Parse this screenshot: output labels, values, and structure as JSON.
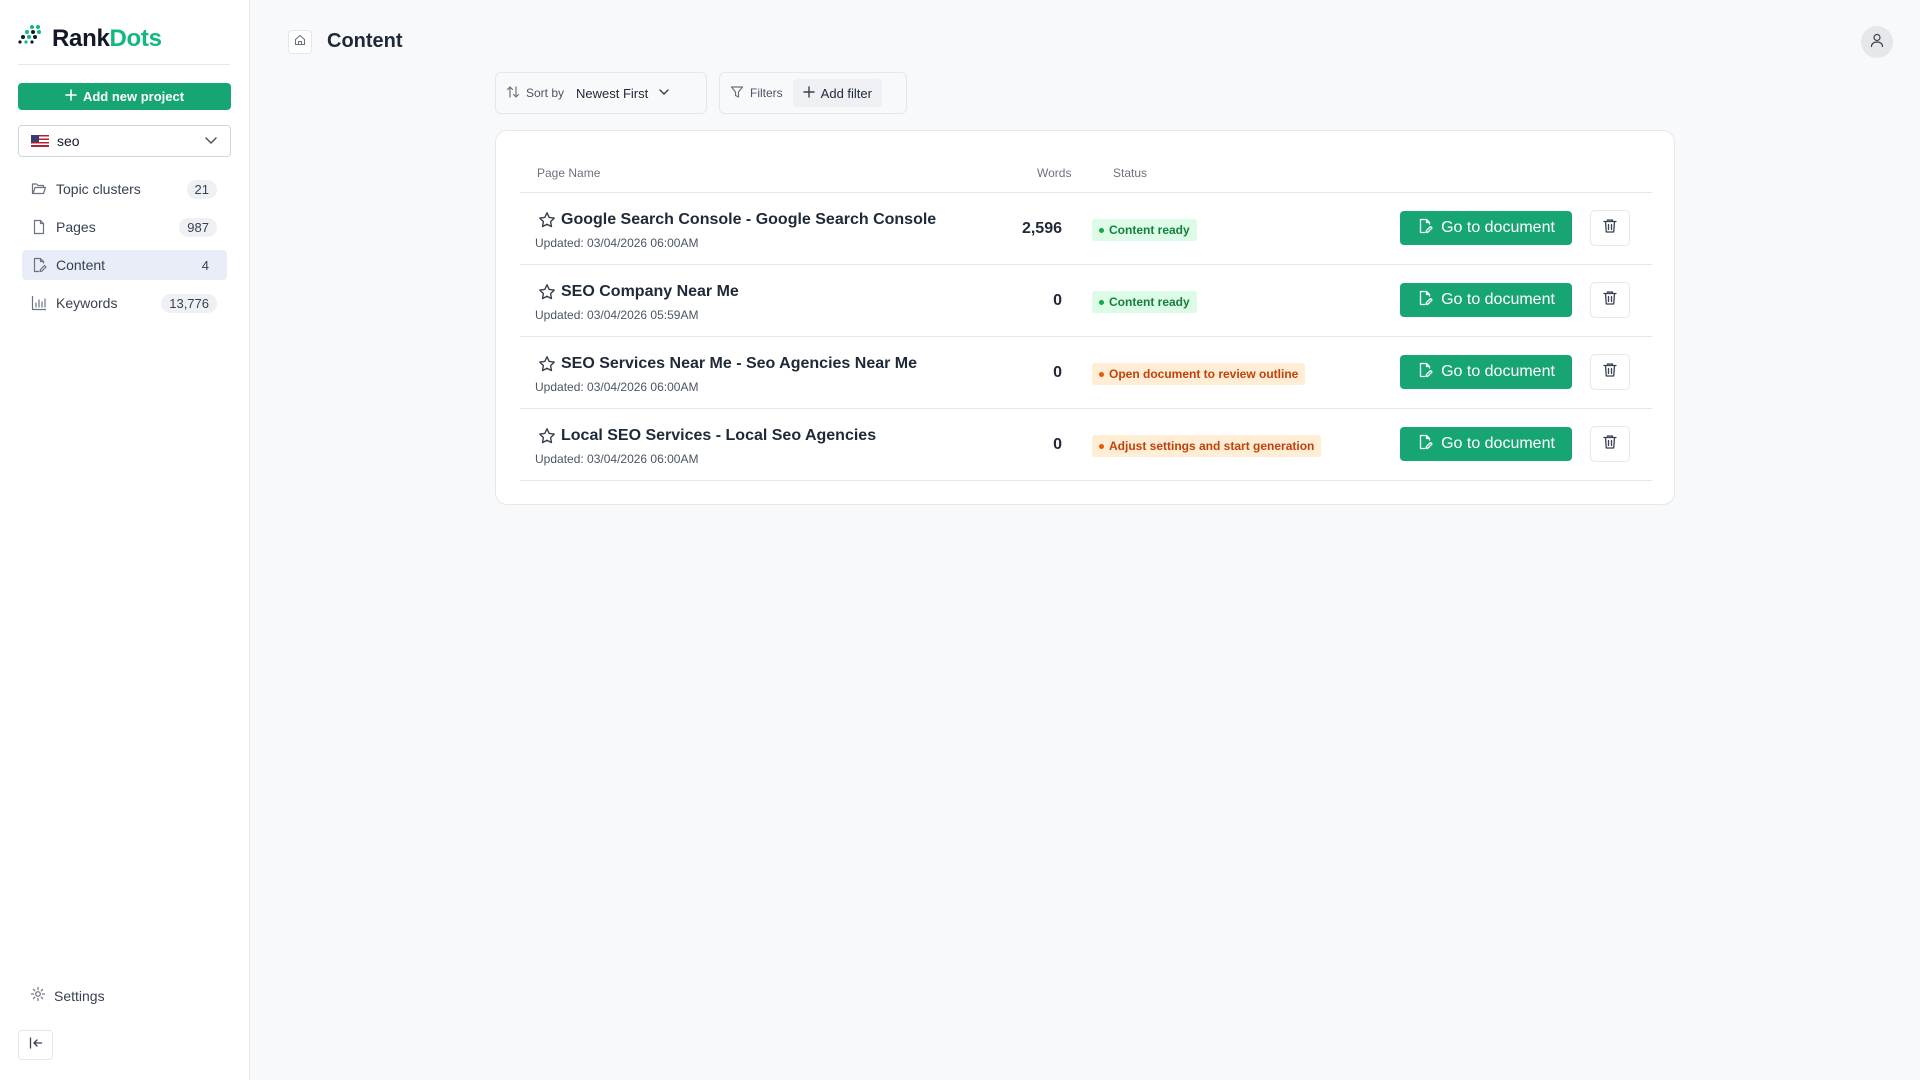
{
  "brand": {
    "name_part1": "Rank",
    "name_part2": "Dots",
    "accent": "#10b981"
  },
  "sidebar": {
    "add_project_label": "Add new project",
    "project": {
      "name": "seo",
      "flag": "us-flag-icon"
    },
    "items": [
      {
        "label": "Topic clusters",
        "count": "21",
        "icon": "folder-icon",
        "active": false
      },
      {
        "label": "Pages",
        "count": "987",
        "icon": "file-icon",
        "active": false
      },
      {
        "label": "Content",
        "count": "4",
        "icon": "file-edit-icon",
        "active": true
      },
      {
        "label": "Keywords",
        "count": "13,776",
        "icon": "bar-chart-icon",
        "active": false
      }
    ],
    "settings_label": "Settings"
  },
  "header": {
    "title": "Content"
  },
  "toolbar": {
    "sort_label": "Sort by",
    "sort_value": "Newest First",
    "filters_label": "Filters",
    "add_filter_label": "Add filter"
  },
  "table": {
    "columns": {
      "page_name": "Page Name",
      "words": "Words",
      "status": "Status"
    },
    "goto_label": "Go to document",
    "rows": [
      {
        "name": "Google Search Console - Google Search Console",
        "updated": "Updated: 03/04/2026 06:00AM",
        "words": "2,596",
        "status": "Content ready",
        "status_color": "green"
      },
      {
        "name": "SEO Company Near Me",
        "updated": "Updated: 03/04/2026 05:59AM",
        "words": "0",
        "status": "Content ready",
        "status_color": "green"
      },
      {
        "name": "SEO Services Near Me - Seo Agencies Near Me",
        "updated": "Updated: 03/04/2026 06:00AM",
        "words": "0",
        "status": "Open document to review outline",
        "status_color": "orange"
      },
      {
        "name": "Local SEO Services - Local Seo Agencies",
        "updated": "Updated: 03/04/2026 06:00AM",
        "words": "0",
        "status": "Adjust settings and start generation",
        "status_color": "orange"
      }
    ]
  }
}
